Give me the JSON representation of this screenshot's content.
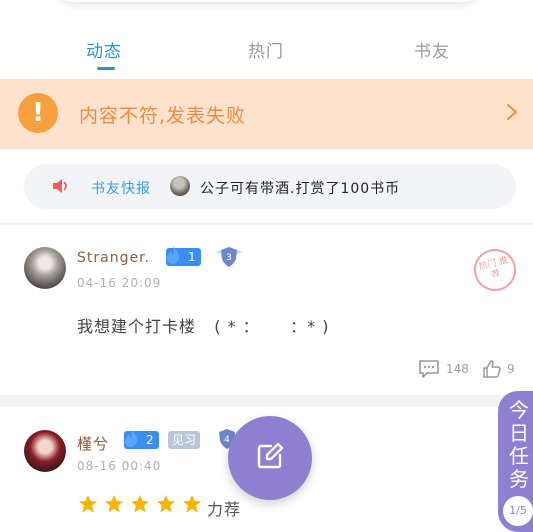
{
  "tabs": [
    {
      "label": "动态",
      "active": true
    },
    {
      "label": "热门",
      "active": false
    },
    {
      "label": "书友",
      "active": false
    }
  ],
  "banner": {
    "icon": "exclamation-icon",
    "icon_text": "!",
    "text": "内容不符,发表失败",
    "chevron": "chevron-right-icon"
  },
  "news": {
    "label": "书友快报",
    "text": "公子可有带酒.打赏了100书币",
    "icon": "speaker-icon"
  },
  "posts": [
    {
      "username": "Stranger.",
      "level": "1",
      "shield_level": "3",
      "time": "04-16 20:09",
      "stamp": "热门 推荐",
      "content": "我想建个打卡楼   ( * ：     ：* )",
      "comments": "148",
      "likes": "9"
    },
    {
      "username": "槿兮",
      "level": "2",
      "role": "见习",
      "shield_level": "4",
      "time": "08-16 00:40",
      "rating": 5,
      "content": "力荐"
    }
  ],
  "fab": {
    "icon": "edit-icon"
  },
  "task_tab": {
    "label": "今日任务",
    "progress": "1/5"
  },
  "colors": {
    "accent_blue": "#2a93d5",
    "banner_bg": "#fde2cd",
    "banner_orange": "#f7a03f",
    "purple": "#8e7fd1",
    "star": "#f7b500"
  }
}
